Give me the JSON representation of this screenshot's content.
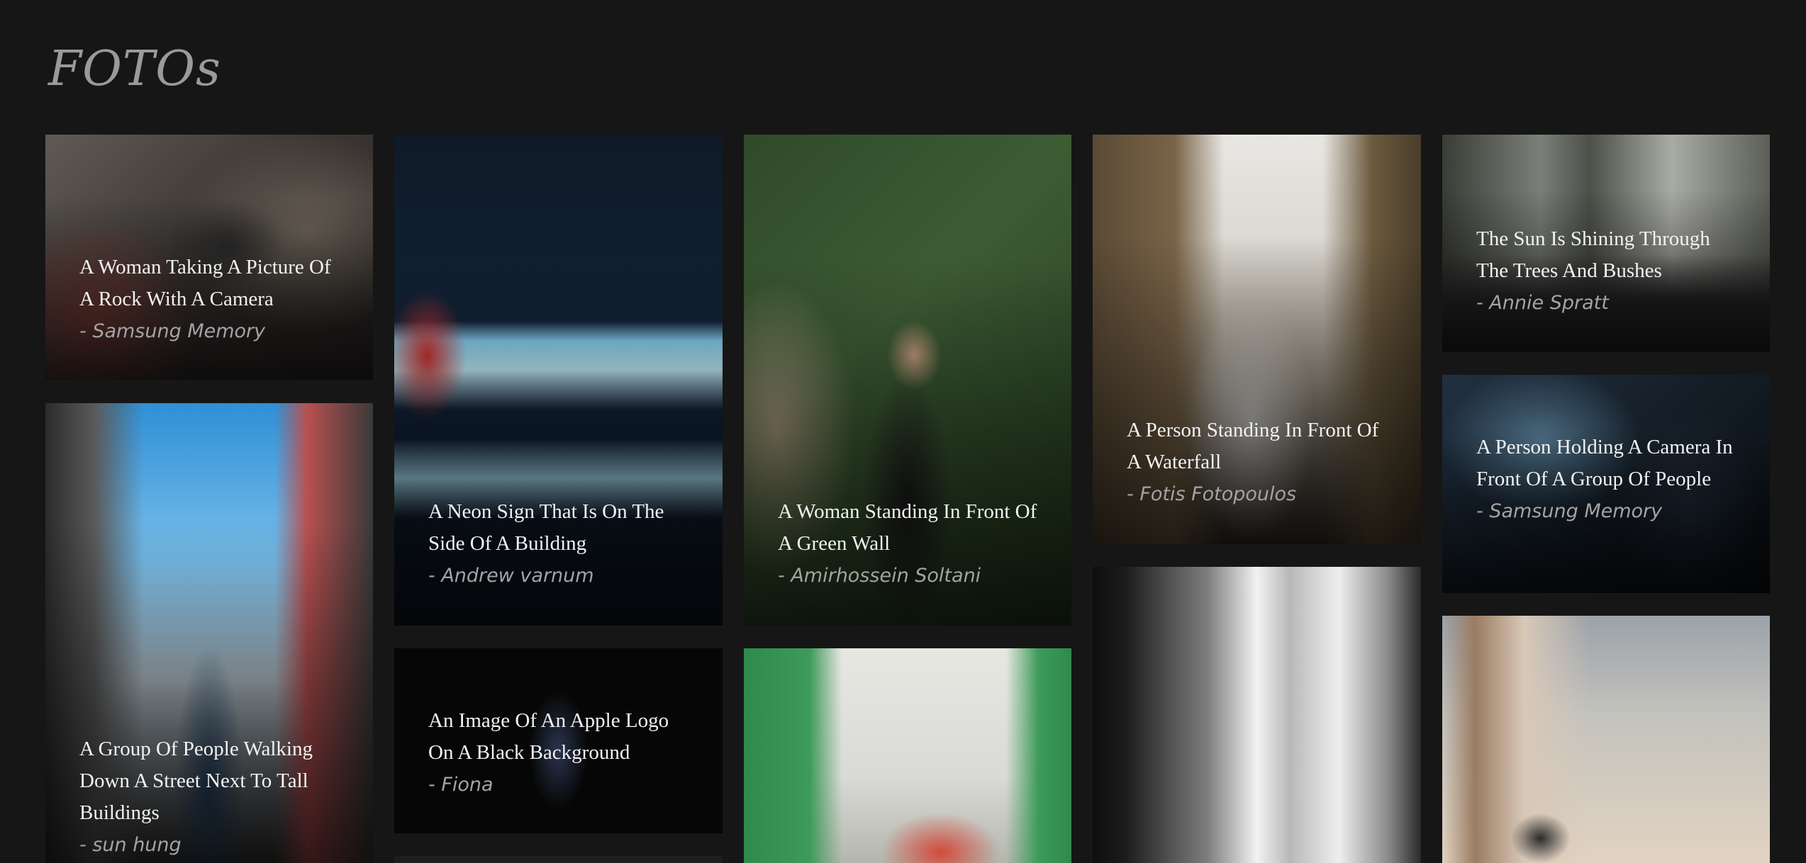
{
  "header": {
    "brand": "FOTOs"
  },
  "cards": [
    {
      "title": "A Woman Taking A Picture Of A Rock With A Camera",
      "author": "- Samsung Memory"
    },
    {
      "title": "A Neon Sign That Is On The Side Of A Building",
      "author": "- Andrew varnum"
    },
    {
      "title": "A Woman Standing In Front Of A Green Wall",
      "author": "- Amirhossein Soltani"
    },
    {
      "title": "A Person Standing In Front Of A Waterfall",
      "author": "- Fotis Fotopoulos"
    },
    {
      "title": "The Sun Is Shining Through The Trees And Bushes",
      "author": "- Annie Spratt"
    },
    {
      "title": "A Person Holding A Camera In Front Of A Group Of People",
      "author": "- Samsung Memory"
    },
    {
      "title": "A Group Of People Walking Down A Street Next To Tall Buildings",
      "author": "- sun hung"
    },
    {
      "title": "An Image Of An Apple Logo On A Black Background",
      "author": "- Fiona"
    }
  ]
}
